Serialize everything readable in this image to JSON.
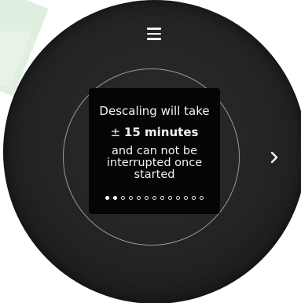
{
  "header": {
    "menu_icon": "hamburger-menu-icon"
  },
  "screen": {
    "line1": "Descaling will take",
    "line2_prefix": "±",
    "line2_bold": "15 minutes",
    "line3": "and can not be",
    "line4": "interrupted once",
    "line5": "started"
  },
  "pagination": {
    "current": 2,
    "total": 13
  },
  "navigation": {
    "next_icon": "chevron-right-icon"
  },
  "colors": {
    "dial": "#232325",
    "screen": "#050505",
    "text": "#f2f2f2",
    "accent": "#dff0e0"
  }
}
